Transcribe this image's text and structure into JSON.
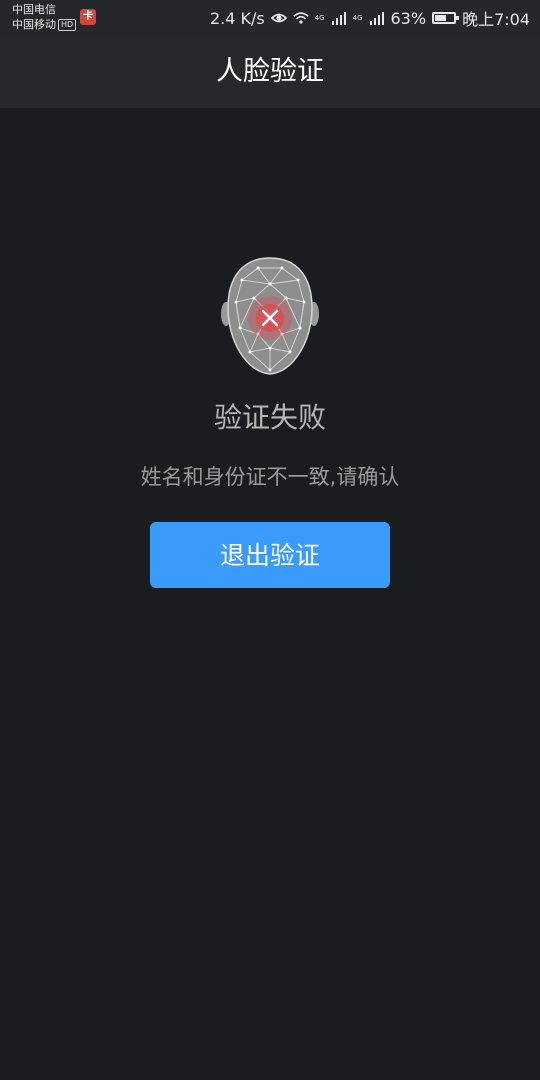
{
  "status_bar": {
    "carrier_1": "中国电信",
    "carrier_2": "中国移动",
    "hd_badge": "HD",
    "network_speed": "2.4 K/s",
    "network_type_1": "4G",
    "network_type_2": "4G",
    "battery_percent": "63%",
    "battery_level": 0.63,
    "time": "晚上7:04",
    "icons": [
      "app-notification-icon",
      "eye-icon",
      "wifi-icon",
      "signal-icon",
      "battery-icon"
    ]
  },
  "header": {
    "title": "人脸验证"
  },
  "result": {
    "title": "验证失败",
    "message": "姓名和身份证不一致,请确认",
    "icon": "face-scan-failed-icon",
    "accent_color": "#e0484f"
  },
  "actions": {
    "exit_label": "退出验证",
    "exit_color": "#3a9bfb"
  }
}
